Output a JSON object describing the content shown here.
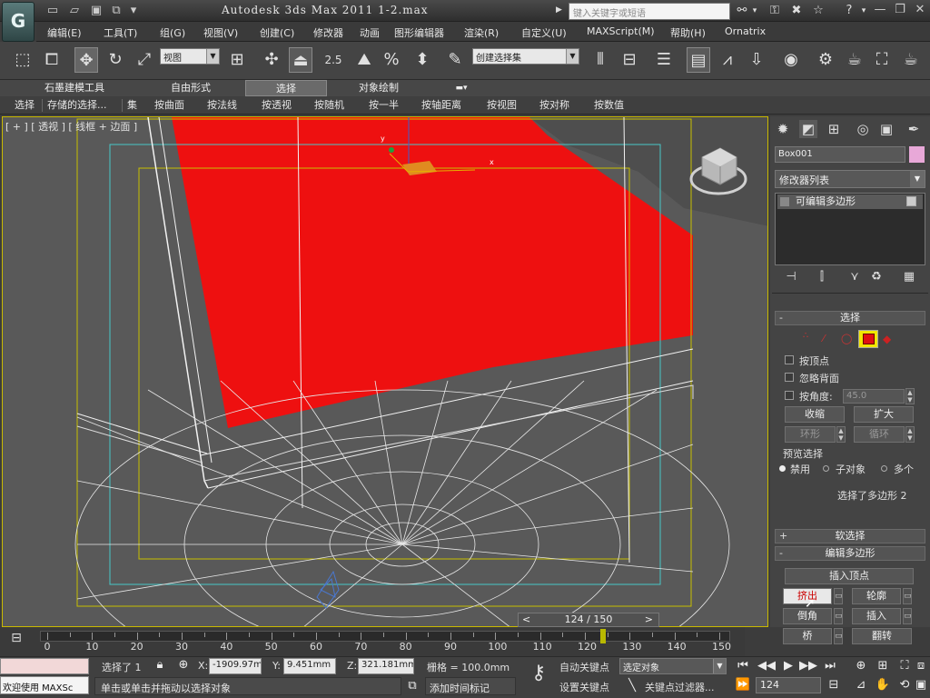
{
  "app": {
    "title": "Autodesk 3ds Max  2011       1-2.max",
    "search_placeholder": "键入关键字或短语",
    "logo": "G"
  },
  "menu": [
    "编辑(E)",
    "工具(T)",
    "组(G)",
    "视图(V)",
    "创建(C)",
    "修改器",
    "动画",
    "图形编辑器",
    "渲染(R)",
    "自定义(U)",
    "MAXScript(M)",
    "帮助(H)",
    "Ornatrix"
  ],
  "toolbar": {
    "view_dropdown": "视图",
    "selection_set_dropdown": "创建选择集",
    "snap_value": "2.5"
  },
  "ribbon": {
    "tabs": [
      "石墨建模工具",
      "自由形式",
      "选择",
      "对象绘制"
    ],
    "active_tab": "选择",
    "buttons": [
      "选择",
      "存储的选择...",
      "集",
      "按曲面",
      "按法线",
      "按透视",
      "按随机",
      "按一半",
      "按轴距离",
      "按视图",
      "按对称",
      "按数值"
    ]
  },
  "viewport": {
    "label": "[ + ] [ 透视 ] [ 线框 + 边面 ]"
  },
  "command_panel": {
    "object_name": "Box001",
    "object_color": "#e8a8d8",
    "modifier_list": "修改器列表",
    "stack_item": "可编辑多边形",
    "selection_rollout": "选择",
    "by_vertex": "按顶点",
    "ignore_backfacing": "忽略背面",
    "by_angle": "按角度:",
    "angle_value": "45.0",
    "shrink": "收缩",
    "grow": "扩大",
    "ring": "环形",
    "loop": "循环",
    "preview_selection": "预览选择",
    "preview_options": [
      "禁用",
      "子对象",
      "多个"
    ],
    "selection_status": "选择了多边形 2",
    "soft_selection": "软选择",
    "edit_polygons": "编辑多边形",
    "insert_vertex": "插入顶点",
    "extrude": "挤出",
    "outline": "轮廓",
    "bevel": "倒角",
    "inset": "插入",
    "bridge": "桥",
    "flip": "翻转"
  },
  "timeline": {
    "frame_display": "124 / 150",
    "current_frame": 124,
    "total_frames": 150,
    "ticks": [
      "0",
      "10",
      "20",
      "30",
      "40",
      "50",
      "60",
      "70",
      "80",
      "90",
      "100",
      "110",
      "120",
      "130",
      "140",
      "150"
    ]
  },
  "status": {
    "welcome": "欢迎使用 MAXSc",
    "selected": "选择了 1",
    "x_label": "X:",
    "x_value": "-1909.97m",
    "y_label": "Y:",
    "y_value": "9.451mm",
    "z_label": "Z:",
    "z_value": "321.181mm",
    "grid": "栅格 = 100.0mm",
    "prompt": "单击或单击并拖动以选择对象",
    "add_time_tag": "添加时间标记",
    "auto_key": "自动关键点",
    "set_key": "设置关键点",
    "selected_object": "选定对象",
    "key_filters": "关键点过滤器...",
    "frame_field": "124"
  }
}
